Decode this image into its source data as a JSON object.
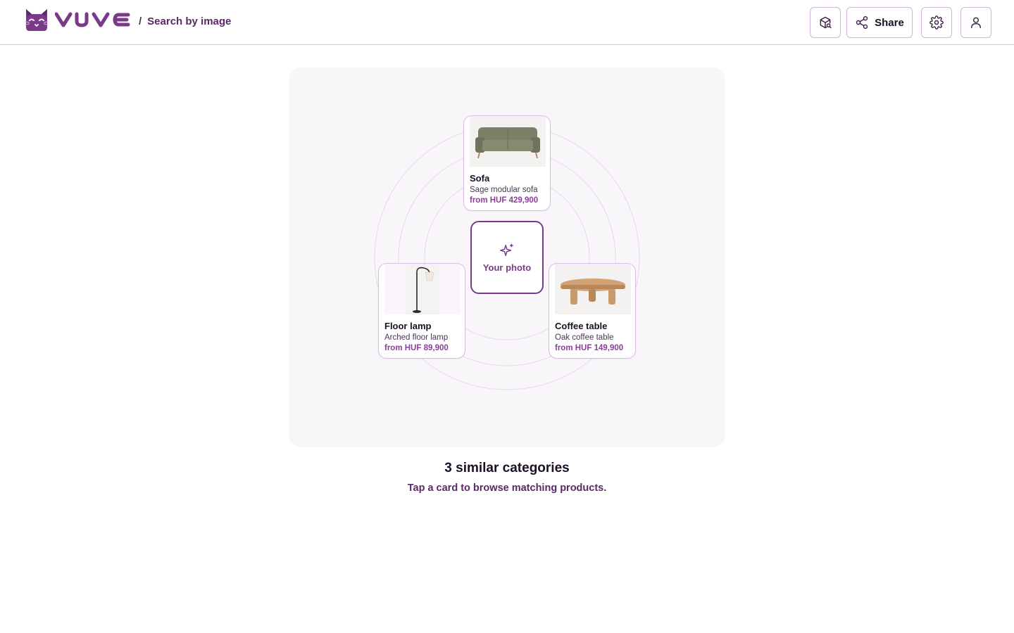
{
  "header": {
    "brand": "VUVE",
    "crumb_sep": "/",
    "crumb": "Search by image",
    "share_label": "Share"
  },
  "icons": {
    "ar": "ar-view-icon",
    "share": "share-icon",
    "settings": "gear-icon",
    "user": "user-icon",
    "sparkle": "sparkles-icon"
  },
  "colors": {
    "brand": "#5a2a66",
    "accent": "#7a3a8a",
    "price": "#8a3e9a",
    "stage_bg": "#f9f6fa"
  },
  "center": {
    "label": "Your photo"
  },
  "cards": [
    {
      "title": "Sofa",
      "desc": "Sage modular sofa",
      "price": "from HUF 429,900"
    },
    {
      "title": "Floor lamp",
      "desc": "Arched floor lamp",
      "price": "from HUF 89,900"
    },
    {
      "title": "Coffee table",
      "desc": "Oak coffee table",
      "price": "from HUF 149,900"
    }
  ],
  "summary": {
    "title": "3 similar categories",
    "subtitle": "Tap a card to browse matching products."
  }
}
